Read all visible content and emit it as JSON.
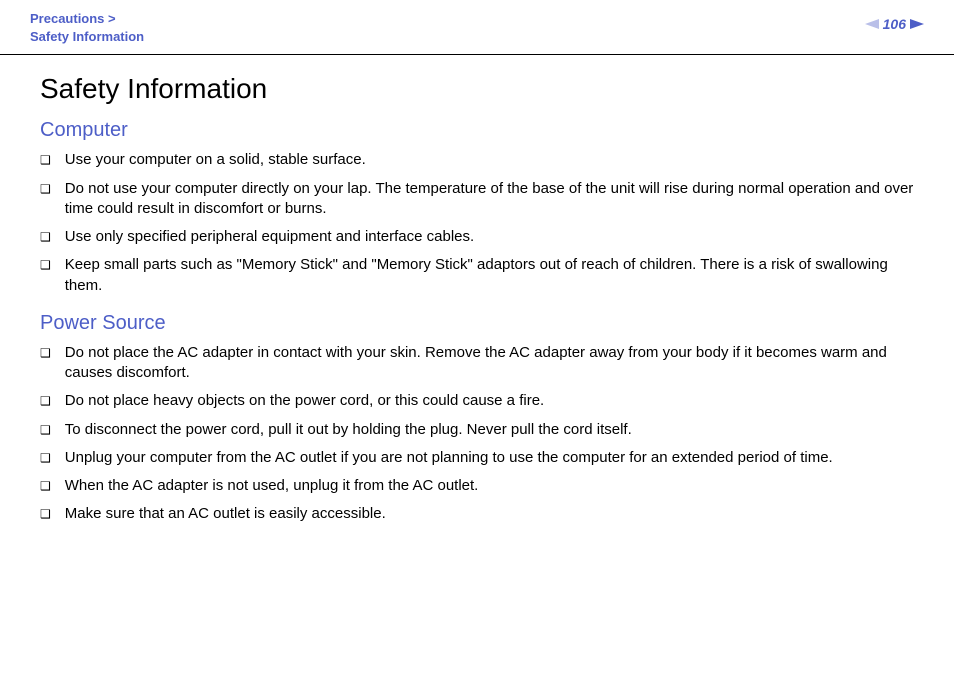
{
  "header": {
    "breadcrumb_top": "Precautions",
    "breadcrumb_sep": ">",
    "breadcrumb_bottom": "Safety Information",
    "page_number": "106"
  },
  "title": "Safety Information",
  "sections": [
    {
      "heading": "Computer",
      "items": [
        "Use your computer on a solid, stable surface.",
        "Do not use your computer directly on your lap. The temperature of the base of the unit will rise during normal operation and over time could result in discomfort or burns.",
        "Use only specified peripheral equipment and interface cables.",
        "Keep small parts such as \"Memory Stick\" and \"Memory Stick\" adaptors out of reach of children. There is a risk of swallowing them."
      ]
    },
    {
      "heading": "Power Source",
      "items": [
        "Do not place the AC adapter in contact with your skin. Remove the AC adapter away from your body if it becomes warm and causes discomfort.",
        "Do not place heavy objects on the power cord, or this could cause a fire.",
        "To disconnect the power cord, pull it out by holding the plug. Never pull the cord itself.",
        "Unplug your computer from the AC outlet if you are not planning to use the computer for an extended period of time.",
        "When the AC adapter is not used, unplug it from the AC outlet.",
        "Make sure that an AC outlet is easily accessible."
      ]
    }
  ]
}
